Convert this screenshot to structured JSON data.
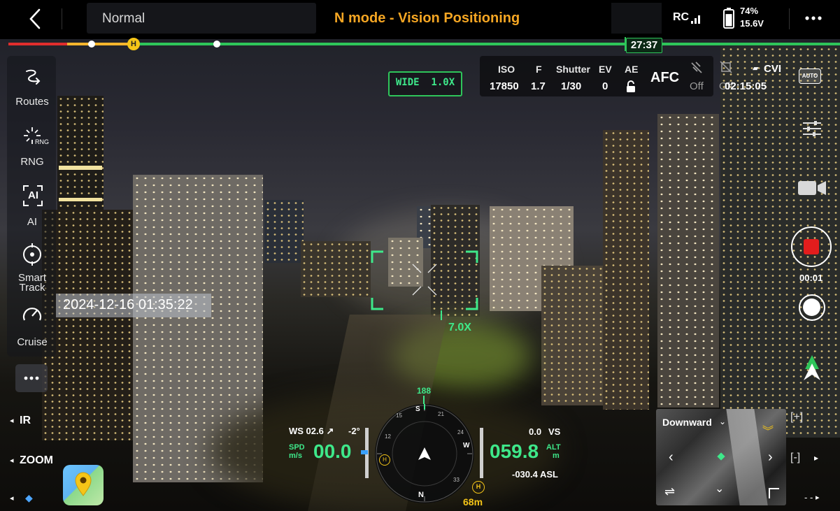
{
  "top_bar": {
    "back_icon": "chevron-left-icon",
    "flight_mode": "Normal",
    "status": "N mode - Vision Positioning",
    "rc_label": "RC",
    "battery_percent": "74%",
    "battery_voltage": "15.6V",
    "battery_level": 0.74,
    "menu_icon": "more-horizontal-icon"
  },
  "progress": {
    "home_marker": "H",
    "remaining_time": "27:37",
    "colors": {
      "danger": "#e02d2d",
      "warning": "#f5b52d",
      "safe": "#2ec55a"
    }
  },
  "left_rail": {
    "items": [
      {
        "label": "Routes",
        "icon": "routes-icon"
      },
      {
        "label": "RNG",
        "icon": "rangefinder-icon",
        "icon_text": "RNG"
      },
      {
        "label": "AI",
        "icon": "ai-icon",
        "icon_text": "AI"
      },
      {
        "label": "Smart\nTrack",
        "label_line1": "Smart",
        "label_line2": "Track",
        "icon": "smart-track-icon"
      },
      {
        "label": "Cruise",
        "icon": "cruise-speedometer-icon"
      }
    ],
    "more_icon": "more-horizontal-icon",
    "ir_label": "IR",
    "zoom_label": "ZOOM"
  },
  "timestamp": "2024-12-16 01:35:22",
  "camera": {
    "lens_label": "WIDE  1.0X",
    "zoom_target": "7.0X",
    "params": {
      "iso_label": "ISO",
      "iso_value": "17850",
      "f_label": "F",
      "f_value": "1.7",
      "shutter_label": "Shutter",
      "shutter_value": "1/30",
      "ev_label": "EV",
      "ev_value": "0",
      "ae_label": "AE",
      "ae_icon": "unlock-icon",
      "focus": "AFC",
      "light1_value": "Off",
      "light2_value": "Off",
      "storage_label": "CVI",
      "storage_time": "02:15:05",
      "auto_badge": "AUTO"
    }
  },
  "right_rail": {
    "adjust_icon": "sliders-icon",
    "video_icon": "video-camera-icon",
    "record_time": "00:01",
    "shutter_icon": "photo-shutter-icon",
    "nav_icon": "navigation-arrow-icon"
  },
  "hud": {
    "wind": "WS 02.6 ↗",
    "wind_angle": "-2°",
    "spd_label": "SPD",
    "spd_unit": "m/s",
    "speed": "00.0",
    "heading": "188",
    "vs_value": "0.0",
    "vs_label": "VS",
    "altitude": "059.8",
    "alt_label": "ALT",
    "alt_unit": "m",
    "asl": "-030.4 ASL",
    "home_distance": "68m",
    "compass": {
      "n": "N",
      "s": "S",
      "w": "W",
      "t1": "21",
      "t2": "24",
      "t3": "33",
      "t4": "15",
      "t5": "12"
    }
  },
  "minimap": {
    "title": "Downward",
    "zoom_in": "[+]",
    "zoom_out": "[-]",
    "dash": "- -"
  }
}
